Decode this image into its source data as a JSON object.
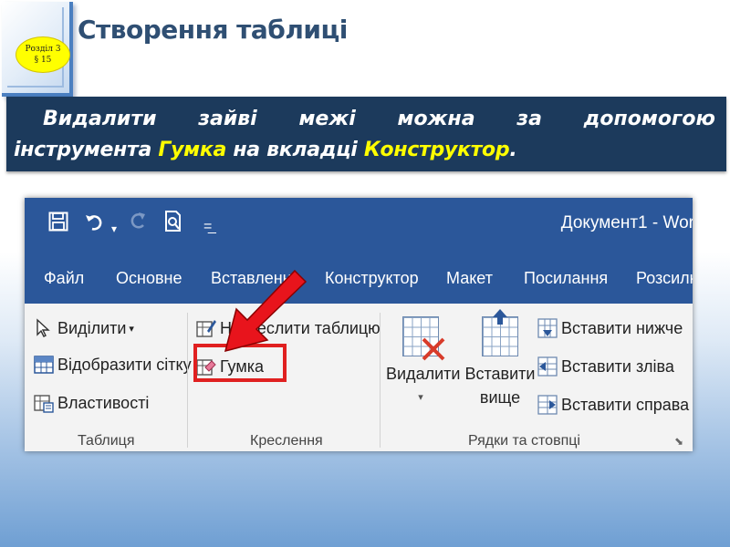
{
  "slide": {
    "section": "Розділ 3",
    "paragraph": "§ 15",
    "title": "Створення таблиці",
    "band_line1_words": [
      "Видалити",
      "зайві",
      "межі",
      "можна",
      "за",
      "допомогою"
    ],
    "band_line2_a": "інструмента ",
    "band_tool": "Гумка",
    "band_line2_b": " на вкладці ",
    "band_tab": "Конструктор",
    "band_end": "."
  },
  "word": {
    "doc_title": "Документ1 - Wor",
    "qat_icons": [
      "save-icon",
      "undo-icon",
      "redo-icon",
      "print-preview-icon",
      "customize-qat-icon"
    ],
    "tabs": [
      "Файл",
      "Основне",
      "Вставлення",
      "Конструктор",
      "Макет",
      "Посилання",
      "Розсилк"
    ],
    "table_group": {
      "select": "Виділити",
      "gridlines": "Відобразити сітку",
      "properties": "Властивості",
      "label": "Таблиця"
    },
    "draw_group": {
      "draw_table": "Накреслити таблицю",
      "eraser": "Гумка",
      "label": "Креслення"
    },
    "rows_group": {
      "delete_line1": "Видалити",
      "insert_line1": "Вставити",
      "insert_line2": "вище",
      "insert_below": "Вставити нижче",
      "insert_left": "Вставити зліва",
      "insert_right": "Вставити справа",
      "label": "Рядки та стовпці"
    },
    "accent_color": "#2b579a",
    "highlight_color": "#e02020"
  }
}
